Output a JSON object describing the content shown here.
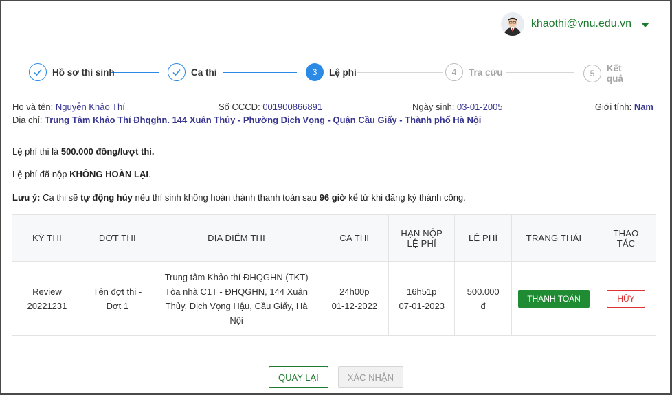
{
  "header": {
    "email": "khaothi@vnu.edu.vn"
  },
  "stepper": {
    "steps": [
      {
        "num": "1",
        "label": "Hồ sơ thí sinh",
        "state": "done"
      },
      {
        "num": "2",
        "label": "Ca thi",
        "state": "done"
      },
      {
        "num": "3",
        "label": "Lệ phí",
        "state": "active"
      },
      {
        "num": "4",
        "label": "Tra cứu",
        "state": "todo"
      },
      {
        "num": "5",
        "label": "Kết quả",
        "state": "todo"
      }
    ]
  },
  "candidate": {
    "name_label": "Họ và tên:",
    "name": "Nguyễn Khảo Thí",
    "id_label": "Số CCCD:",
    "id": "001900866891",
    "dob_label": "Ngày sinh:",
    "dob": "03-01-2005",
    "gender_label": "Giới tính:",
    "gender": "Nam",
    "address_label": "Địa chỉ:",
    "address": "Trung Tâm Khảo Thí Đhqghn. 144 Xuân Thủy - Phường Dịch Vọng - Quận Cầu Giấy - Thành phố Hà Nội"
  },
  "notices": {
    "fee_prefix": "Lệ phí thi là",
    "fee_amount": "500.000 đồng/lượt thi.",
    "nonrefund_prefix": "Lệ phí đã nộp",
    "nonrefund_bold": "KHÔNG HOÀN LẠI",
    "nonrefund_suffix": ".",
    "note_label": "Lưu ý:",
    "note_1": "Ca thi sẽ",
    "note_bold_1": "tự động hủy",
    "note_2": "nếu thí sinh không hoàn thành thanh toán sau",
    "note_bold_2": "96 giờ",
    "note_3": "kể từ khi đăng ký thành công."
  },
  "table": {
    "headers": {
      "exam": "KỲ THI",
      "batch": "ĐỢT THI",
      "location": "ĐỊA ĐIỂM THI",
      "shift": "CA THI",
      "deadline_1": "HẠN NỘP",
      "deadline_2": "LỆ PHÍ",
      "fee": "LỆ PHÍ",
      "status": "TRẠNG THÁI",
      "action_1": "THAO",
      "action_2": "TÁC"
    },
    "rows": [
      {
        "exam_1": "Review",
        "exam_2": "20221231",
        "batch_1": "Tên đợt thi -",
        "batch_2": "Đợt 1",
        "loc_1": "Trung tâm Khảo thí ĐHQGHN (TKT)",
        "loc_2": "Tòa nhà C1T - ĐHQGHN, 144 Xuân",
        "loc_3": "Thủy, Dịch Vọng Hậu, Cầu Giấy, Hà",
        "loc_4": "Nội",
        "shift_time": "24h00p",
        "shift_date": "01-12-2022",
        "deadline_time": "16h51p",
        "deadline_date": "07-01-2023",
        "fee_1": "500.000",
        "fee_2": "đ",
        "pay_label": "THANH TOÁN",
        "cancel_label": "HỦY"
      }
    ]
  },
  "footer": {
    "back_label": "QUAY LẠI",
    "confirm_label": "XÁC NHẬN"
  },
  "colors": {
    "accent_green": "#1d7a2e",
    "step_blue": "#2b8ae6",
    "value_purple": "#38358f",
    "danger_red": "#d33"
  }
}
